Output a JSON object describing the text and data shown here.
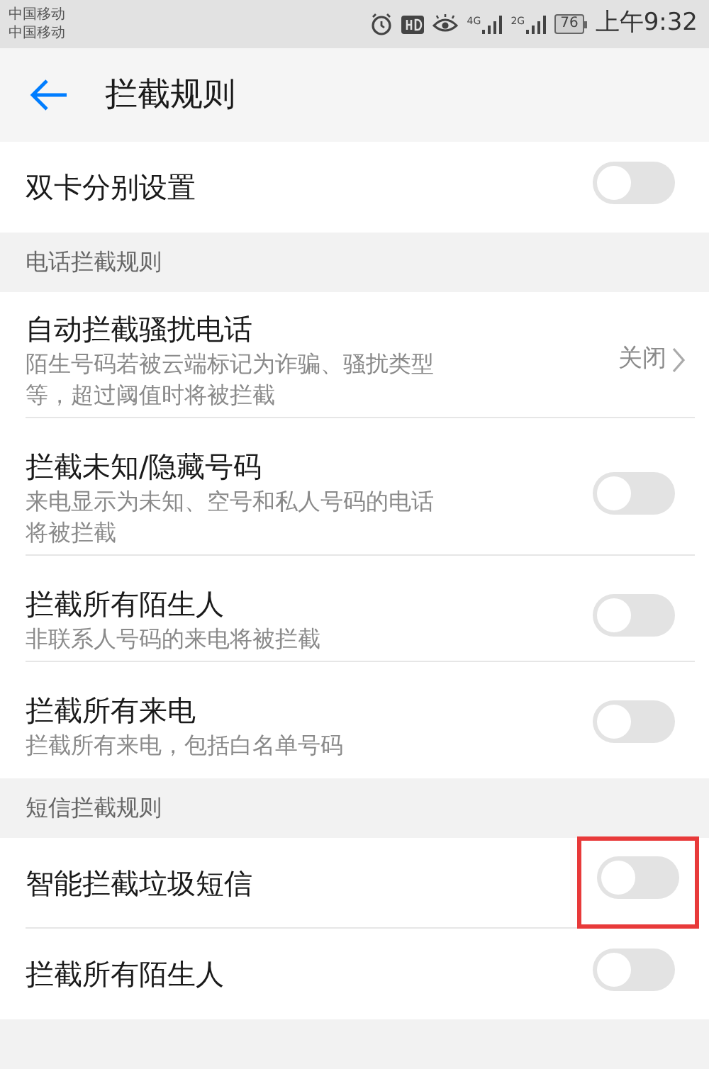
{
  "status_bar": {
    "carriers": [
      "中国移动",
      "中国移动"
    ],
    "network_labels": [
      "4G",
      "2G"
    ],
    "battery": "76",
    "time": "上午9:32"
  },
  "header": {
    "title": "拦截规则"
  },
  "sections": [
    {
      "items": [
        {
          "kind": "toggle",
          "title": "双卡分别设置",
          "on": false,
          "highlighted": false
        }
      ]
    },
    {
      "heading": "电话拦截规则",
      "items": [
        {
          "kind": "link",
          "title": "自动拦截骚扰电话",
          "subtitle": "陌生号码若被云端标记为诈骗、骚扰类型等，超过阈值时将被拦截",
          "value": "关闭"
        },
        {
          "kind": "toggle",
          "title": "拦截未知/隐藏号码",
          "subtitle": "来电显示为未知、空号和私人号码的电话将被拦截",
          "on": false,
          "highlighted": false
        },
        {
          "kind": "toggle",
          "title": "拦截所有陌生人",
          "subtitle": "非联系人号码的来电将被拦截",
          "on": false,
          "highlighted": false
        },
        {
          "kind": "toggle",
          "title": "拦截所有来电",
          "subtitle": "拦截所有来电，包括白名单号码",
          "on": false,
          "highlighted": false
        }
      ]
    },
    {
      "heading": "短信拦截规则",
      "items": [
        {
          "kind": "toggle",
          "title": "智能拦截垃圾短信",
          "on": false,
          "highlighted": true
        },
        {
          "kind": "toggle",
          "title": "拦截所有陌生人",
          "on": false,
          "highlighted": false
        }
      ]
    }
  ]
}
